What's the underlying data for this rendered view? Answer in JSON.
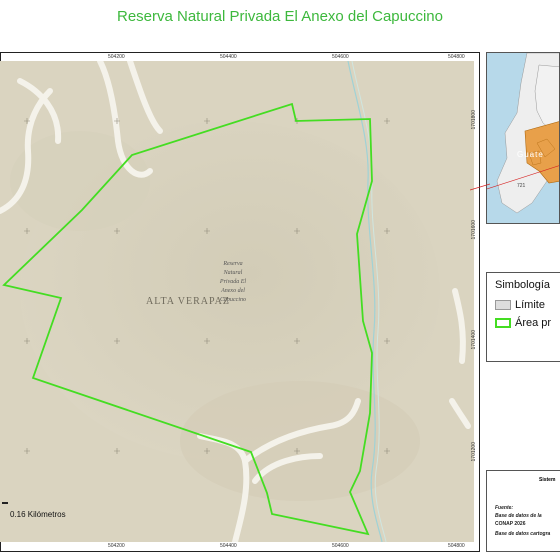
{
  "title": "Reserva Natural Privada El Anexo del Capuccino",
  "map": {
    "reserve_label": [
      "Reserva",
      "Natural",
      "Privada El",
      "Anexo del",
      "Capuccino"
    ],
    "region_label": "ALTA VERAPAZ",
    "x_ticks": [
      "504200",
      "504400",
      "504600",
      "504800"
    ],
    "y_ticks": [
      "1701800",
      "1701600",
      "1701400",
      "1701200"
    ],
    "scale_label": "0.16 Kilómetros",
    "boundary_color": "#44dd22",
    "terrain_color": "#d9d3bf"
  },
  "inset": {
    "label": "Guate",
    "number_label": "721",
    "highlight_color": "#e8a04a",
    "pointer_color": "#d62020"
  },
  "legend": {
    "title": "Simbología",
    "items": [
      {
        "label": "Límite",
        "swatch": "limit-swatch",
        "color": "#dddddd"
      },
      {
        "label": "Área pr",
        "swatch": "protected-swatch",
        "color": "#44dd22"
      }
    ]
  },
  "info": {
    "heading": "Sistem",
    "lines": [
      "Fuente:",
      "Base de datos de la",
      "CONAP 2026",
      "Base de datos cartogra"
    ]
  }
}
